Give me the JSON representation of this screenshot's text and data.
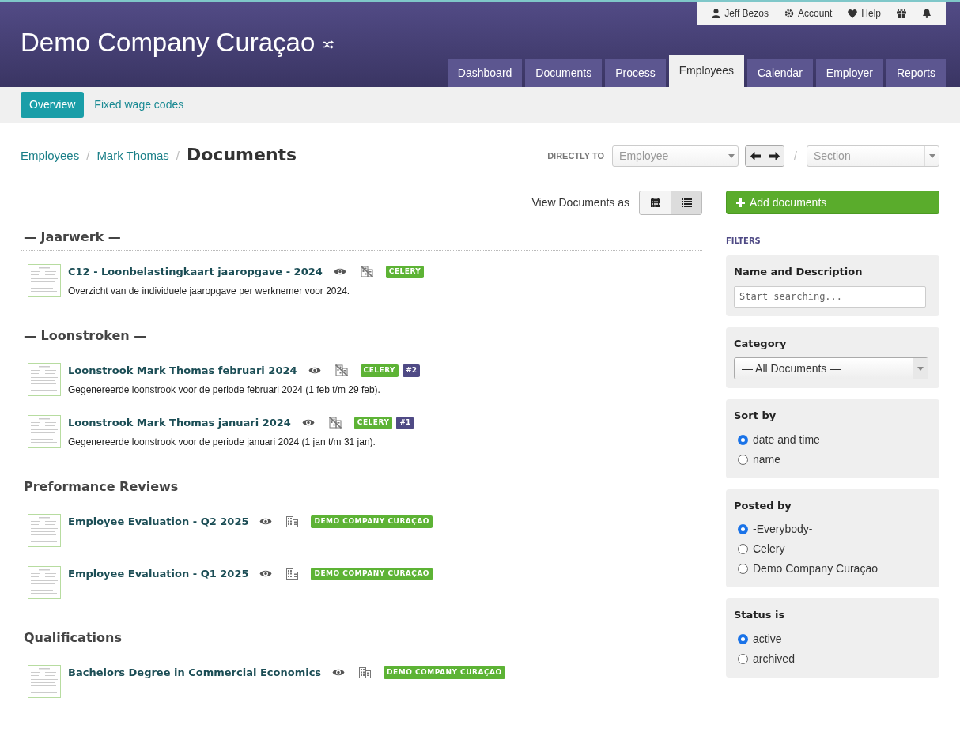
{
  "header": {
    "title": "Demo Company Curaçao",
    "user_menu": [
      "Jeff Bezos",
      "Account",
      "Help"
    ],
    "tabs": [
      {
        "label": "Dashboard",
        "selected": false
      },
      {
        "label": "Documents",
        "selected": false
      },
      {
        "label": "Process",
        "selected": false
      },
      {
        "label": "Employees",
        "selected": true
      },
      {
        "label": "Calendar",
        "selected": false
      },
      {
        "label": "Employer",
        "selected": false
      },
      {
        "label": "Reports",
        "selected": false
      }
    ]
  },
  "subnav": [
    {
      "label": "Overview",
      "selected": true
    },
    {
      "label": "Fixed wage codes",
      "selected": false
    }
  ],
  "breadcrumb": {
    "links": [
      {
        "label": "Employees",
        "separator": "/"
      },
      {
        "label": "Mark Thomas",
        "separator": "/"
      }
    ],
    "current": "Documents"
  },
  "directly_to": {
    "label": "DIRECTLY TO",
    "employee_placeholder": "Employee",
    "separator": "/",
    "section_placeholder": "Section"
  },
  "view_as": {
    "label": "View Documents as",
    "options": [
      {
        "kind": "calendar",
        "selected": false
      },
      {
        "kind": "list",
        "selected": true
      }
    ]
  },
  "add_button": "Add documents",
  "sections": [
    {
      "title": "— Jaarwerk —",
      "documents": [
        {
          "title": "C12 - Loonbelastingkaart jaaropgave - 2024",
          "description": "Overzicht van de individuele jaaropgave per werknemer voor 2024.",
          "company_visible": false,
          "tag": "CELERY"
        }
      ]
    },
    {
      "title": "— Loonstroken —",
      "documents": [
        {
          "title": "Loonstrook Mark Thomas februari 2024",
          "description": "Gegenereerde loonstrook voor de periode februari 2024 (1 feb t/m 29 feb).",
          "company_visible": false,
          "tag": "CELERY",
          "number": "#2"
        },
        {
          "title": "Loonstrook Mark Thomas januari 2024",
          "description": "Gegenereerde loonstrook voor de periode januari 2024 (1 jan t/m 31 jan).",
          "company_visible": false,
          "tag": "CELERY",
          "number": "#1"
        }
      ]
    },
    {
      "title": "Preformance Reviews",
      "documents": [
        {
          "title": "Employee Evaluation - Q2 2025",
          "company_visible": true,
          "tag": "DEMO COMPANY CURAÇAO"
        },
        {
          "title": "Employee Evaluation - Q1 2025",
          "company_visible": true,
          "tag": "DEMO COMPANY CURAÇAO"
        }
      ]
    },
    {
      "title": "Qualifications",
      "documents": [
        {
          "title": "Bachelors Degree in Commercial Economics",
          "company_visible": true,
          "tag": "DEMO COMPANY CURAÇAO"
        }
      ]
    }
  ],
  "filters": {
    "title": "FILTERS",
    "name_filter": {
      "label": "Name and Description",
      "placeholder": "Start searching..."
    },
    "category": {
      "label": "Category",
      "value": "— All Documents —"
    },
    "radio_groups": [
      {
        "label": "Sort by",
        "options": [
          {
            "label": "date and time",
            "selected": true
          },
          {
            "label": "name",
            "selected": false
          }
        ]
      },
      {
        "label": "Posted by",
        "options": [
          {
            "label": "-Everybody-",
            "selected": true
          },
          {
            "label": "Celery",
            "selected": false
          },
          {
            "label": "Demo Company Curaçao",
            "selected": false
          }
        ]
      },
      {
        "label": "Status is",
        "options": [
          {
            "label": "active",
            "selected": true
          },
          {
            "label": "archived",
            "selected": false
          }
        ]
      }
    ]
  }
}
